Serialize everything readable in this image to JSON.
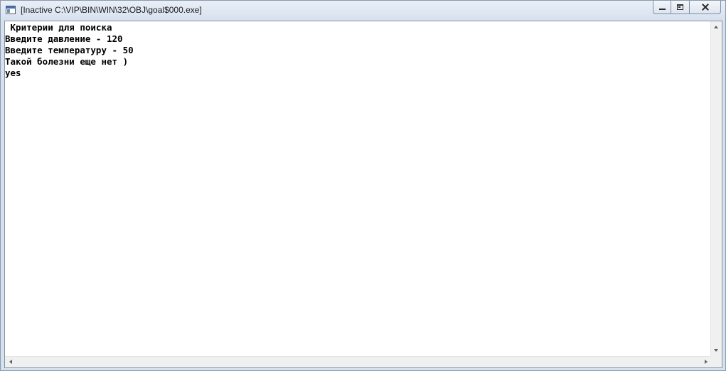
{
  "window": {
    "title": "[Inactive C:\\VIP\\BIN\\WIN\\32\\OBJ\\goal$000.exe]",
    "icon": "console-app-icon"
  },
  "caption_buttons": {
    "minimize": "minimize-icon",
    "maximize": "maximize-icon",
    "close": "close-icon"
  },
  "console": {
    "lines": [
      " Критерии для поиска",
      "Введите давление - 120",
      "Введите температуру - 50",
      "Такой болезни еще нет )",
      "yes"
    ]
  },
  "scrollbars": {
    "vertical": {
      "up": "arrow-up-icon",
      "down": "arrow-down-icon"
    },
    "horizontal": {
      "left": "arrow-left-icon",
      "right": "arrow-right-icon"
    }
  }
}
